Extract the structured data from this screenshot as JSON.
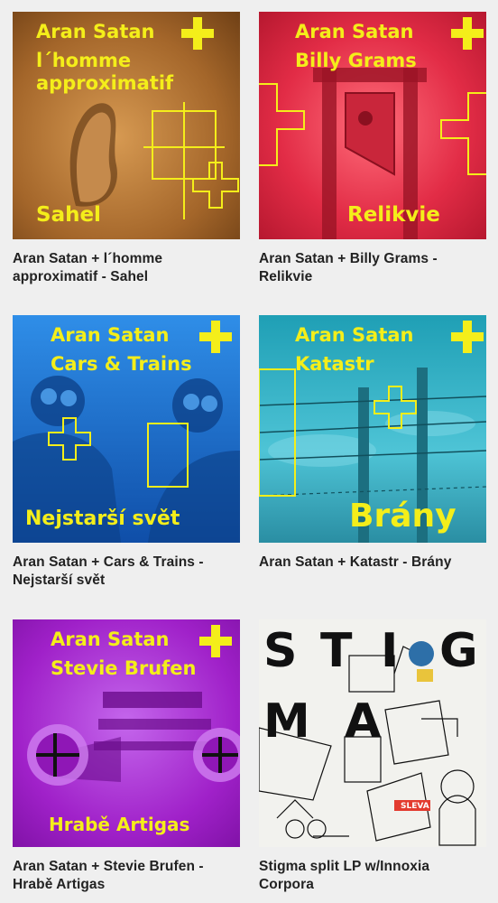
{
  "releases": [
    {
      "cover": {
        "artist": "Aran Satan",
        "collab_line1": "l´homme",
        "collab_line2": "approximatif",
        "title": "Sahel",
        "plus": "+"
      },
      "caption": "Aran Satan + l´homme approximatif - Sahel"
    },
    {
      "cover": {
        "artist": "Aran Satan",
        "collab_line1": "Billy Grams",
        "title": "Relikvie",
        "plus": "+"
      },
      "caption": "Aran Satan + Billy Grams - Relikvie"
    },
    {
      "cover": {
        "artist": "Aran Satan",
        "collab_line1": "Cars & Trains",
        "title": "Nejstarší svět",
        "plus": "+"
      },
      "caption": "Aran Satan + Cars & Trains - Nejstarší svět"
    },
    {
      "cover": {
        "artist": "Aran Satan",
        "collab_line1": "Katastr",
        "title": "Brány",
        "plus": "+"
      },
      "caption": "Aran Satan + Katastr - Brány"
    },
    {
      "cover": {
        "artist": "Aran Satan",
        "collab_line1": "Stevie Brufen",
        "title": "Hrabě Artigas",
        "plus": "+"
      },
      "caption": "Aran Satan + Stevie Brufen - Hrabě Artigas"
    },
    {
      "cover": {
        "letters": [
          "S",
          "T",
          "I",
          "G",
          "M",
          "A"
        ],
        "sign": "SLEVA"
      },
      "caption": "Stigma split LP w/Innoxia Corpora"
    }
  ],
  "colors": {
    "page_bg": "#efefef",
    "caption_text": "#222222",
    "cover_text": "#f4ee1a",
    "sahel_bg": "#a4662a",
    "relikvie_bg": "#d81f3b",
    "nejstarsi_bg": "#1768c8",
    "brany_bg": "#2aa6bd",
    "hrabe_bg": "#a021c9",
    "stigma_bg": "#f2f2ee"
  }
}
